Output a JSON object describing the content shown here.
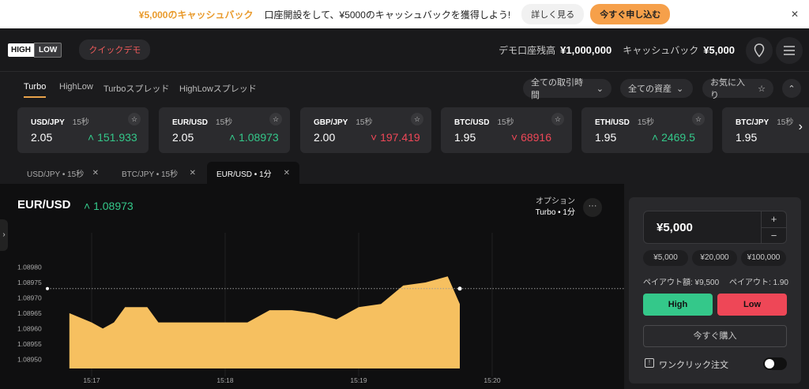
{
  "promo": {
    "highlight": "¥5,000のキャッシュバック",
    "text": "口座開設をして、¥5000のキャッシュバックを獲得しよう!",
    "details_label": "詳しく見る",
    "apply_label": "今すぐ申し込む",
    "close_icon": "close-icon"
  },
  "header": {
    "logo_left": "HIGH",
    "logo_right": "LOW",
    "demo_label": "クイックデモ",
    "balance_label": "デモ口座残高",
    "balance_value": "¥1,000,000",
    "cashback_label": "キャッシュバック",
    "cashback_value": "¥5,000",
    "icons": [
      "location-icon",
      "menu-icon"
    ]
  },
  "tabs": [
    {
      "label": "Turbo",
      "active": true
    },
    {
      "label": "HighLow",
      "active": false
    },
    {
      "label": "Turboスプレッド",
      "active": false
    },
    {
      "label": "HighLowスプレッド",
      "active": false
    }
  ],
  "filters": {
    "time_label": "全ての取引時間",
    "asset_label": "全ての資産",
    "favorites_label": "お気に入り",
    "collapse_icon": "chevron-up-icon"
  },
  "cards": [
    {
      "pair": "USD/JPY",
      "duration": "15秒",
      "payout": "2.05",
      "price": "151.933",
      "trend": "up"
    },
    {
      "pair": "EUR/USD",
      "duration": "15秒",
      "payout": "2.05",
      "price": "1.08973",
      "trend": "up"
    },
    {
      "pair": "GBP/JPY",
      "duration": "15秒",
      "payout": "2.00",
      "price": "197.419",
      "trend": "down"
    },
    {
      "pair": "BTC/USD",
      "duration": "15秒",
      "payout": "1.95",
      "price": "68916",
      "trend": "down"
    },
    {
      "pair": "ETH/USD",
      "duration": "15秒",
      "payout": "1.95",
      "price": "2469.5",
      "trend": "up"
    },
    {
      "pair": "BTC/JPY",
      "duration": "15秒",
      "payout": "1.95",
      "price": "",
      "trend": "down"
    }
  ],
  "open_tabs": [
    {
      "label": "USD/JPY • 15秒",
      "active": false
    },
    {
      "label": "BTC/JPY • 15秒",
      "active": false
    },
    {
      "label": "EUR/USD • 1分",
      "active": true
    }
  ],
  "chart": {
    "title": "EUR/USD",
    "price": "1.08973",
    "option_label": "オプション",
    "option_value": "Turbo • 1分"
  },
  "chart_data": {
    "type": "area",
    "color": "#f6c060",
    "x": [
      "15:16:50",
      "15:17:00",
      "15:17:05",
      "15:17:10",
      "15:17:15",
      "15:17:20",
      "15:17:25",
      "15:17:30",
      "15:17:40",
      "15:17:50",
      "15:18:00",
      "15:18:10",
      "15:18:20",
      "15:18:30",
      "15:18:40",
      "15:18:50",
      "15:19:00",
      "15:19:10",
      "15:19:20",
      "15:19:30",
      "15:19:40",
      "15:19:50",
      "15:19:58"
    ],
    "values": [
      1.08965,
      1.08962,
      1.0896,
      1.08962,
      1.08967,
      1.08967,
      1.08967,
      1.08962,
      1.08962,
      1.08962,
      1.08962,
      1.08962,
      1.08966,
      1.08966,
      1.08965,
      1.08963,
      1.08967,
      1.08968,
      1.08974,
      1.08975,
      1.08977,
      1.08968,
      1.08973
    ],
    "yticks": [
      "1.08980",
      "1.08975",
      "1.08970",
      "1.08965",
      "1.08960",
      "1.08955",
      "1.08950"
    ],
    "xticks": [
      "15:17",
      "15:18",
      "15:19",
      "15:20"
    ],
    "ylim": [
      1.08947,
      1.08984
    ],
    "grid": true
  },
  "trade": {
    "amount": "¥5,000",
    "plus": "+",
    "minus": "−",
    "presets": [
      "¥5,000",
      "¥20,000",
      "¥100,000"
    ],
    "payout_amount": "ペイアウト額: ¥9,500",
    "payout_rate": "ペイアウト: 1.90",
    "high_label": "High",
    "low_label": "Low",
    "buy_label": "今すぐ購入",
    "oneclick_label": "ワンクリック注文"
  }
}
